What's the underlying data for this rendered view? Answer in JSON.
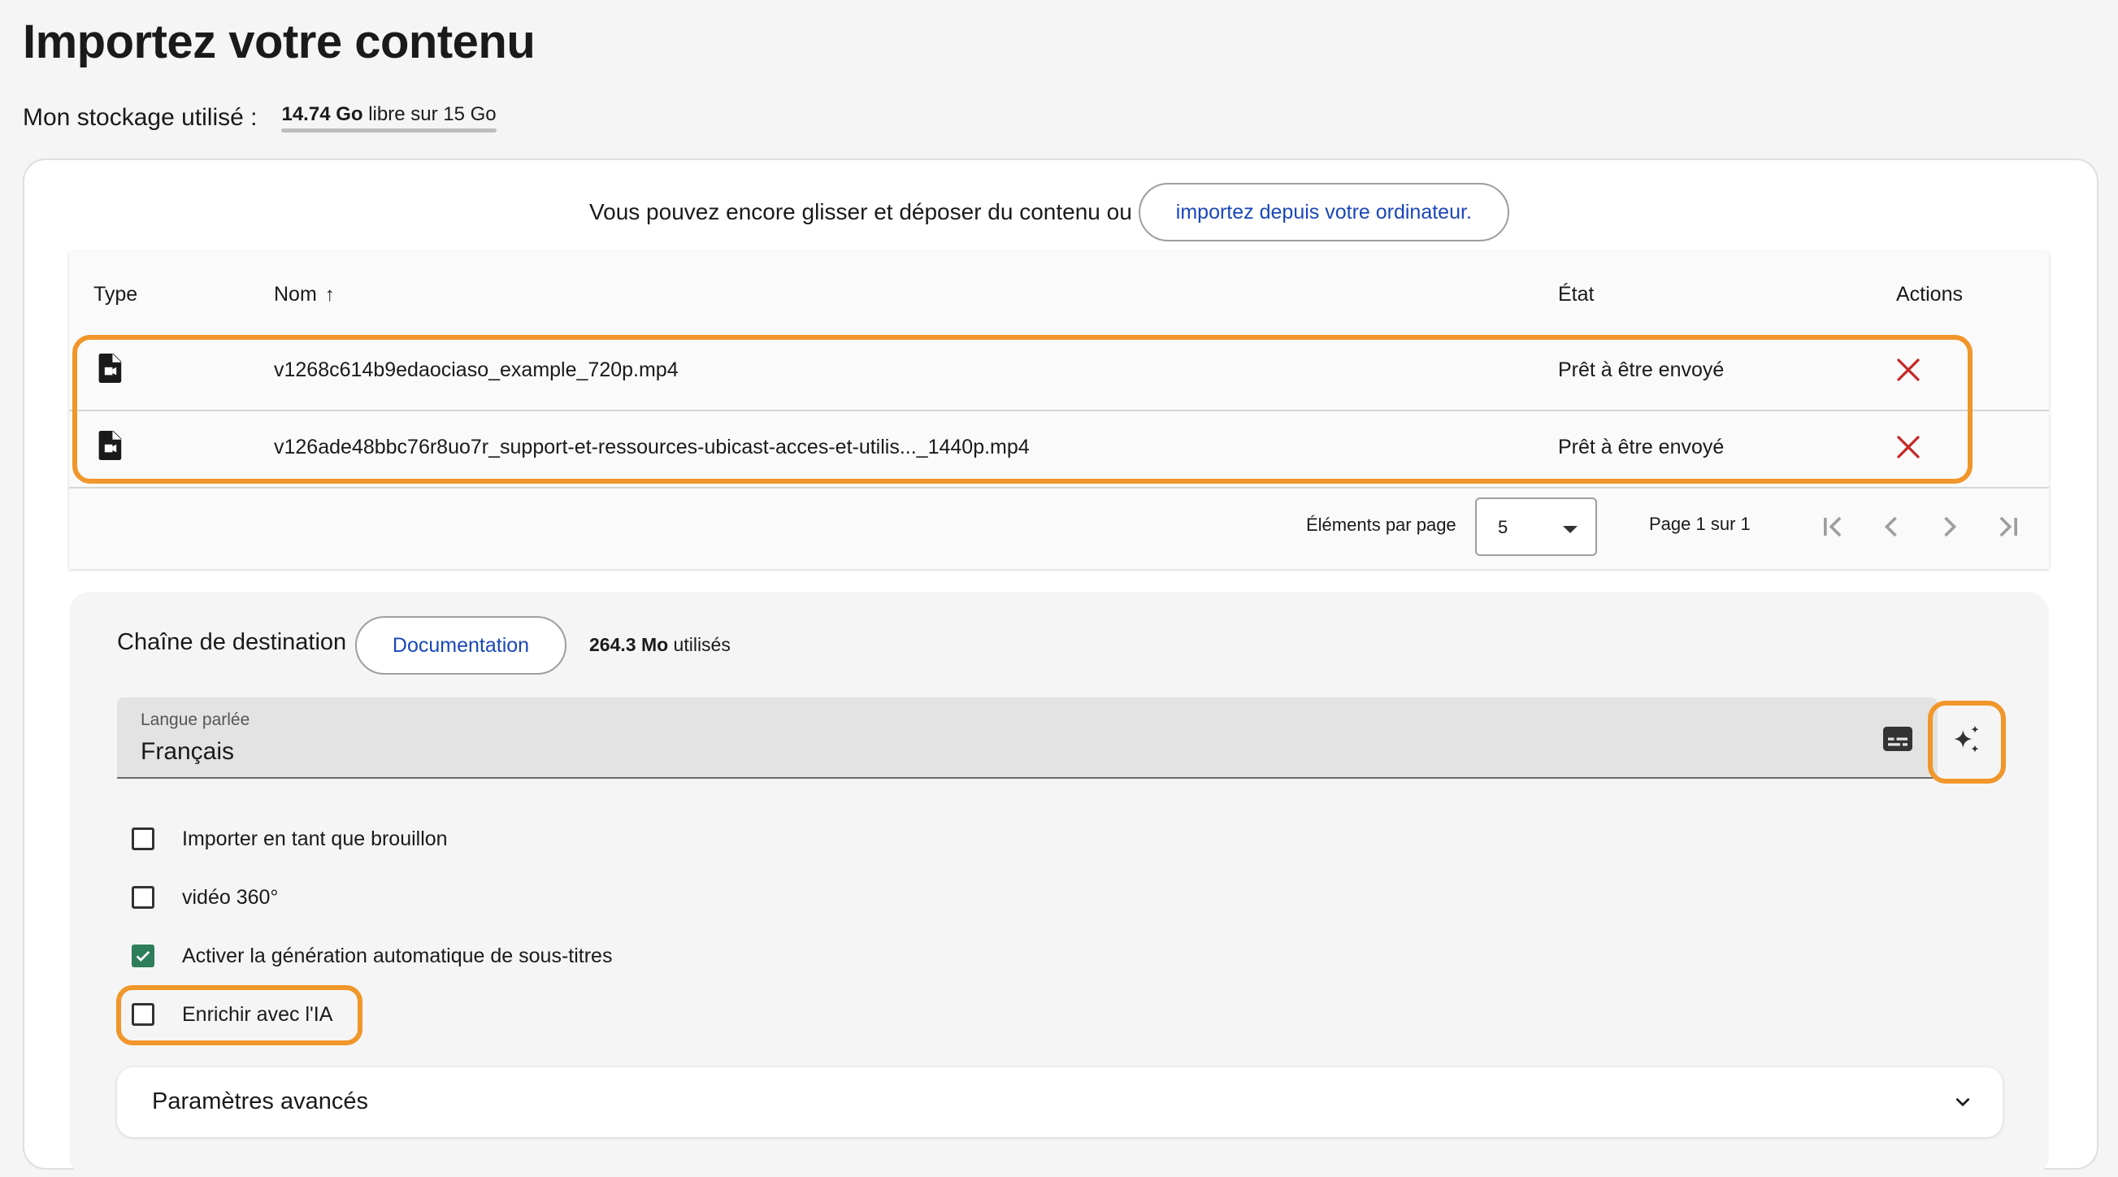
{
  "header": {
    "title": "Importez votre contenu",
    "storage_label": "Mon stockage utilisé :",
    "storage_free": "14.74 Go",
    "storage_rest": "libre sur 15 Go",
    "storage_used_fraction": 0.017
  },
  "dropzone": {
    "text": "Vous pouvez encore glisser et déposer du contenu ou",
    "import_button": "importez depuis votre ordinateur."
  },
  "table": {
    "columns": {
      "type": "Type",
      "name": "Nom",
      "status": "État",
      "actions": "Actions"
    },
    "sort_arrow": "↑",
    "rows": [
      {
        "type_icon": "video-file-icon",
        "name": "v1268c614b9edaociaso_example_720p.mp4",
        "status": "Prêt à être envoyé",
        "action_icon": "close-icon"
      },
      {
        "type_icon": "video-file-icon",
        "name": "v126ade48bbc76r8uo7r_support-et-ressources-ubicast-acces-et-utilis..._1440p.mp4",
        "status": "Prêt à être envoyé",
        "action_icon": "close-icon"
      }
    ],
    "pagination": {
      "per_page_label": "Éléments par page",
      "per_page_value": "5",
      "page_info": "Page 1 sur 1"
    }
  },
  "destination": {
    "label": "Chaîne de destination",
    "doc_button": "Documentation",
    "usage_value": "264.3 Mo",
    "usage_suffix": "utilisés",
    "language": {
      "label": "Langue parlée",
      "value": "Français"
    },
    "options": [
      {
        "label": "Importer en tant que brouillon",
        "checked": false
      },
      {
        "label": "vidéo 360°",
        "checked": false
      },
      {
        "label": "Activer la génération automatique de sous-titres",
        "checked": true
      },
      {
        "label": "Enrichir avec l'IA",
        "checked": false
      }
    ],
    "advanced_label": "Paramètres avancés"
  },
  "colors": {
    "accent_green": "#2e7d5b",
    "link_blue": "#1a47b8",
    "remove_red": "#c62828",
    "highlight_orange": "#f0962a"
  }
}
